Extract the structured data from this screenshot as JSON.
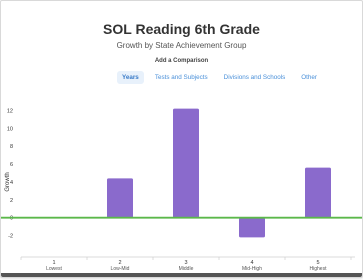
{
  "header": {
    "title": "SOL Reading 6th Grade",
    "subtitle": "Growth by State Achievement Group",
    "add_comparison": "Add a Comparison"
  },
  "tabs": [
    {
      "label": "Years",
      "active": true
    },
    {
      "label": "Tests and Subjects",
      "active": false
    },
    {
      "label": "Divisions and Schools",
      "active": false
    },
    {
      "label": "Other",
      "active": false
    }
  ],
  "colors": {
    "bar": "#8a6acc",
    "zero_line": "#5bb84a",
    "accent": "#4a90d9"
  },
  "chart_data": {
    "type": "bar",
    "categories": [
      "1",
      "2",
      "3",
      "4",
      "5"
    ],
    "category_labels": [
      "Lowest",
      "Low-Mid",
      "Middle",
      "Mid-High",
      "Highest"
    ],
    "values": [
      null,
      4.4,
      12.2,
      -2.2,
      5.6
    ],
    "ylabel": "Growth",
    "ylim": [
      -3.5,
      13.5
    ],
    "yticks": [
      -2,
      0,
      2,
      4,
      6,
      8,
      10,
      12
    ],
    "grid": false
  }
}
